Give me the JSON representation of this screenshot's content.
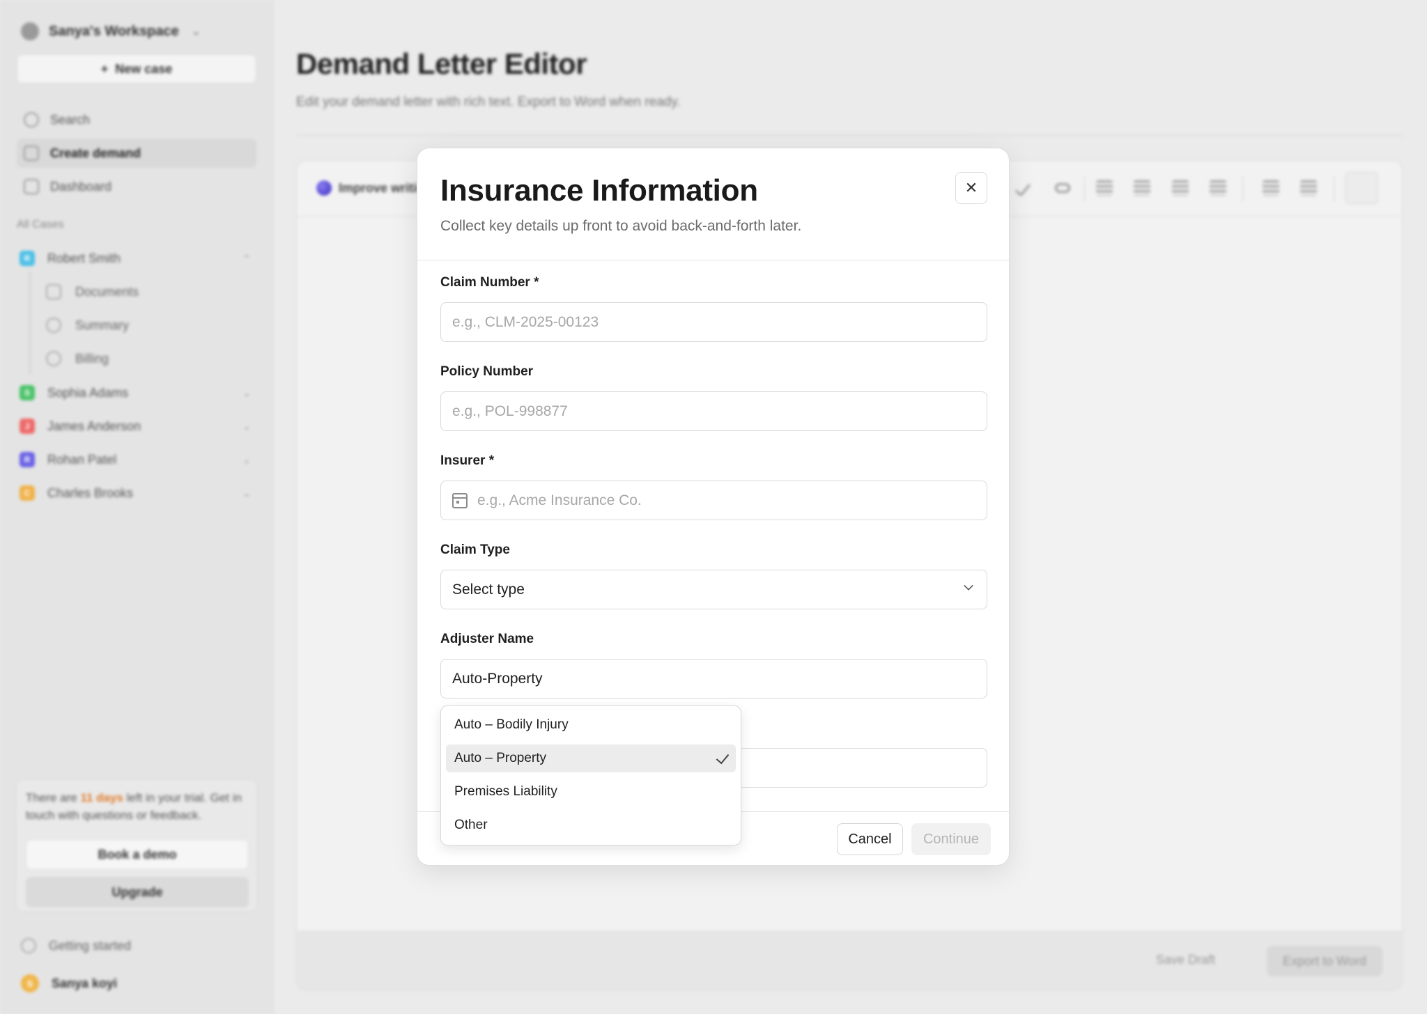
{
  "workspace": {
    "name": "Sanya's Workspace"
  },
  "sidebar": {
    "new_case_label": "New case",
    "nav": [
      {
        "label": "Search",
        "icon": "search-icon"
      },
      {
        "label": "Create demand",
        "icon": "document-icon",
        "active": true
      },
      {
        "label": "Dashboard",
        "icon": "folder-icon"
      }
    ],
    "section_label": "All Cases",
    "cases": [
      {
        "initial": "R",
        "name": "Robert Smith",
        "color": "#4cc0e6",
        "expanded": true
      },
      {
        "initial": "S",
        "name": "Sophia Adams",
        "color": "#4cc46a"
      },
      {
        "initial": "J",
        "name": "James Anderson",
        "color": "#ee6a6a"
      },
      {
        "initial": "R",
        "name": "Rohan Patel",
        "color": "#6a62e6"
      },
      {
        "initial": "C",
        "name": "Charles Brooks",
        "color": "#f0b24a"
      }
    ],
    "sub_items": [
      "Documents",
      "Summary",
      "Billing"
    ],
    "trial": {
      "prefix": "There are ",
      "highlight": "11 days",
      "suffix": " left in your trial. Get in touch with questions or feedback.",
      "demo_label": "Book a demo",
      "upgrade_label": "Upgrade"
    },
    "getting_started": "Getting started",
    "user": {
      "initial": "S",
      "name": "Sanya koyi"
    }
  },
  "main": {
    "title": "Demand Letter Editor",
    "subtitle": "Edit your demand letter with rich text. Export to Word when ready.",
    "improve_label": "Improve writing",
    "save_draft_label": "Save Draft",
    "export_label": "Export to Word"
  },
  "modal": {
    "title": "Insurance Information",
    "subtitle": "Collect key details up front to avoid back-and-forth later.",
    "close_icon": "close-icon",
    "fields": {
      "claim_number": {
        "label": "Claim Number *",
        "placeholder": "e.g., CLM-2025-00123"
      },
      "policy_number": {
        "label": "Policy Number",
        "placeholder": "e.g., POL-998877"
      },
      "insurer": {
        "label": "Insurer *",
        "placeholder": "e.g., Acme Insurance Co.",
        "icon": "calendar-icon"
      },
      "claim_type": {
        "label": "Claim Type",
        "value": "Select type"
      },
      "adjuster_name": {
        "label": "Adjuster Name",
        "value": "Auto-Property"
      }
    },
    "cancel_label": "Cancel",
    "continue_label": "Continue"
  },
  "dropdown": {
    "options": [
      "Auto – Bodily Injury",
      "Auto – Property",
      "Premises Liability",
      "Other"
    ],
    "selected": "Auto – Property"
  }
}
